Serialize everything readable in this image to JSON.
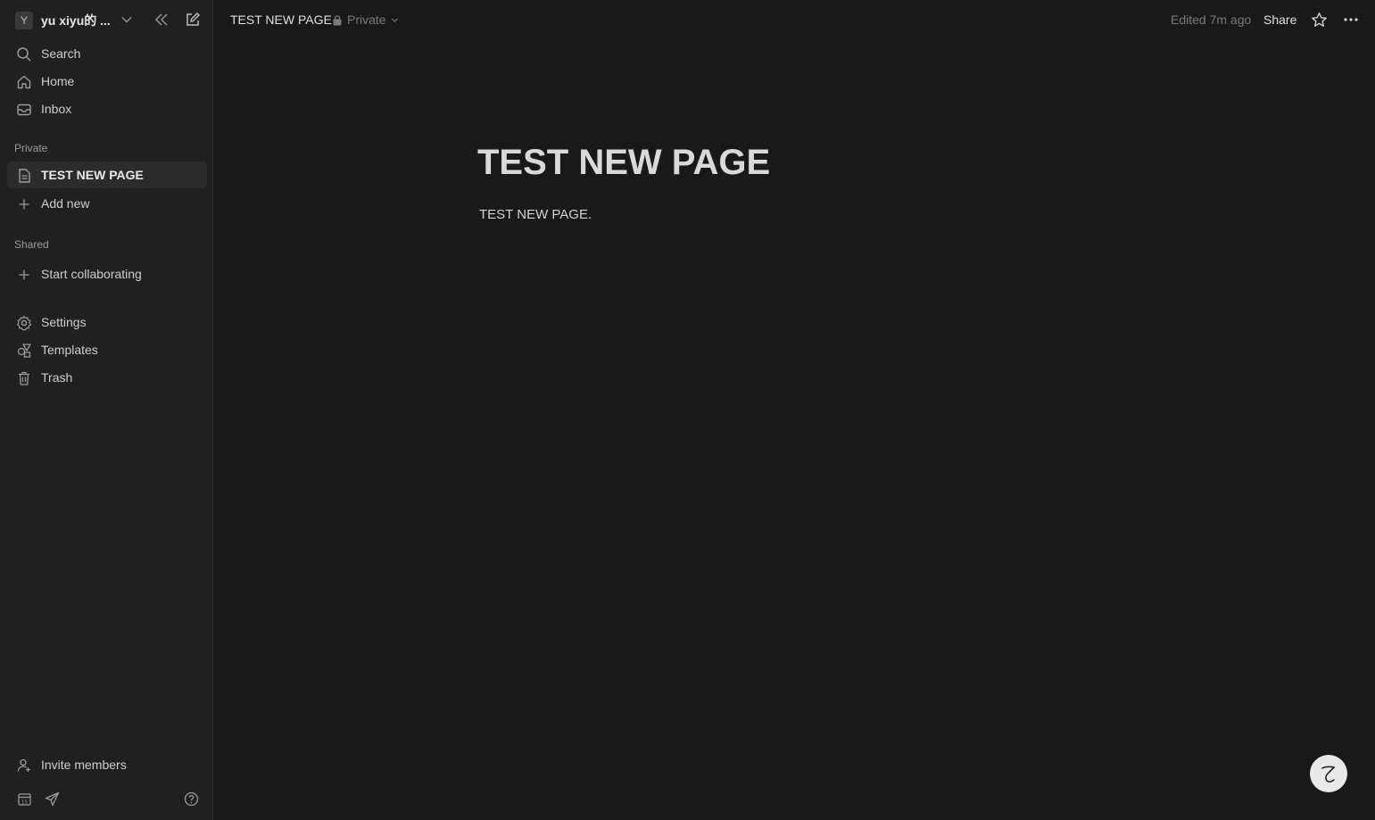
{
  "workspace": {
    "initial": "Y",
    "name": "yu xiyu的 ..."
  },
  "sidebar": {
    "top_items": [
      {
        "label": "Search",
        "icon": "search-icon"
      },
      {
        "label": "Home",
        "icon": "home-icon"
      },
      {
        "label": "Inbox",
        "icon": "inbox-icon"
      }
    ],
    "private_label": "Private",
    "private_items": [
      {
        "label": "TEST NEW PAGE",
        "icon": "page-icon"
      },
      {
        "label": "Add new",
        "icon": "plus-icon"
      }
    ],
    "shared_label": "Shared",
    "shared_items": [
      {
        "label": "Start collaborating",
        "icon": "plus-icon"
      }
    ],
    "bottom_items": [
      {
        "label": "Settings",
        "icon": "gear-icon"
      },
      {
        "label": "Templates",
        "icon": "templates-icon"
      },
      {
        "label": "Trash",
        "icon": "trash-icon"
      }
    ],
    "invite_label": "Invite members"
  },
  "topbar": {
    "page_title": "TEST NEW PAGE",
    "privacy": "Private",
    "edited": "Edited 7m ago",
    "share": "Share"
  },
  "page": {
    "title": "TEST NEW PAGE",
    "body": "TEST NEW PAGE."
  },
  "colors": {
    "background": "#191919",
    "sidebar": "#202020",
    "active_item": "#2c2c2c"
  }
}
